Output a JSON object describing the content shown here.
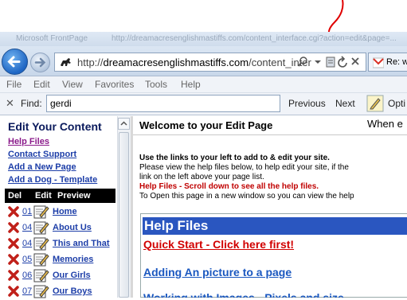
{
  "browser": {
    "title_strip": [
      "Microsoft FrontPage",
      "http://dreamacresenglishmastiffs.com/content_interface.cgi?action=edit&page=...",
      "Re: ..."
    ],
    "address": {
      "prefix": "http://",
      "domain": "dreamacresenglishmastiffs.com",
      "path": "/content_inter"
    },
    "tab_label": "Re: w"
  },
  "menu": [
    "File",
    "Edit",
    "View",
    "Favorites",
    "Tools",
    "Help"
  ],
  "findbar": {
    "label": "Find:",
    "value": "gerdi",
    "previous": "Previous",
    "next": "Next",
    "options": "Opti"
  },
  "left": {
    "title": "Edit Your Content",
    "links": [
      "Help Files",
      "Contact Support",
      "Add a New Page",
      "Add a Dog - Template"
    ],
    "table_header": {
      "del": "Del",
      "edit": "Edit",
      "preview": "Preview"
    },
    "rows": [
      {
        "num": "01",
        "label": "Home"
      },
      {
        "num": "04",
        "label": "About Us"
      },
      {
        "num": "04",
        "label": "This and That"
      },
      {
        "num": "05",
        "label": "Memories"
      },
      {
        "num": "06",
        "label": "Our Girls"
      },
      {
        "num": "07",
        "label": "Our Boys"
      }
    ]
  },
  "right": {
    "title": "Welcome to your Edit Page",
    "when": "When e",
    "para1": "Use the links to your left to add to & edit your site.",
    "para2": "Please view the help files below, to help edit your site, if the",
    "para3": "link on the left above your page list.",
    "para4": "Help Files - Scroll down to see all the help files.",
    "para5": "To Open this page in a new window so you can view the help",
    "help_header": "Help Files",
    "quick_start": "Quick Start - Click here first!",
    "adding_picture": "Adding An picture to a page",
    "cut_off": "Working with Images - Pixels and size"
  },
  "colors": {
    "annotation": "#e00000",
    "help_header_bg": "#2a56c0",
    "link_blue": "#1d3ea8",
    "visited_purple": "#8a1a8a",
    "help_red": "#d10000"
  }
}
